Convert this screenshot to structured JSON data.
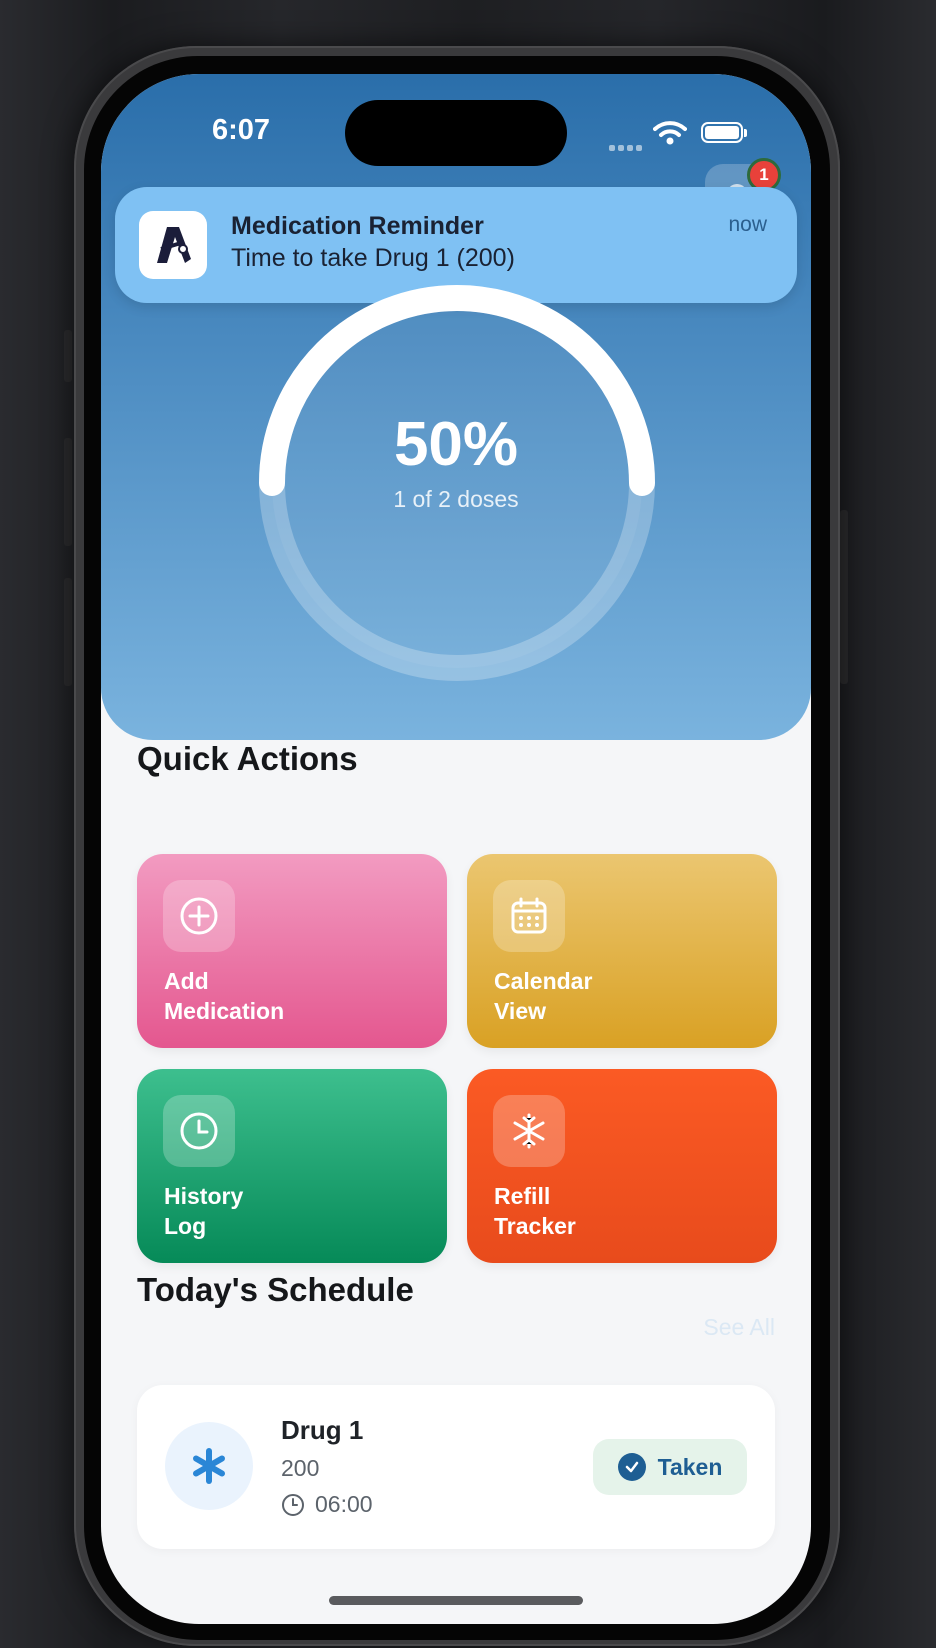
{
  "status_bar": {
    "time": "6:07"
  },
  "header": {
    "notification_count": "1"
  },
  "notification": {
    "title": "Medication Reminder",
    "body": "Time to take Drug 1 (200)",
    "time": "now",
    "app_icon": "app-logo-icon"
  },
  "progress": {
    "percent_label": "50%",
    "fraction": 0.5,
    "doses_label": "1 of 2 doses"
  },
  "quick_actions": {
    "title": "Quick Actions",
    "items": [
      {
        "line1": "Add",
        "line2": "Medication",
        "icon": "plus-circle-icon",
        "color": "#e8629a"
      },
      {
        "line1": "Calendar",
        "line2": "View",
        "icon": "calendar-icon",
        "color": "#dea93a"
      },
      {
        "line1": "History",
        "line2": "Log",
        "icon": "clock-icon",
        "color": "#1aa571"
      },
      {
        "line1": "Refill",
        "line2": "Tracker",
        "icon": "snowflake-icon",
        "color": "#f45420"
      }
    ]
  },
  "schedule": {
    "title": "Today's Schedule",
    "see_all": "See All",
    "items": [
      {
        "name": "Drug 1",
        "dose": "200",
        "time": "06:00",
        "status": "Taken",
        "icon": "asterisk-icon"
      }
    ]
  },
  "colors": {
    "accent": "#1e5e93",
    "hero_top": "#2a6eaa",
    "hero_bottom": "#7ab3de"
  }
}
